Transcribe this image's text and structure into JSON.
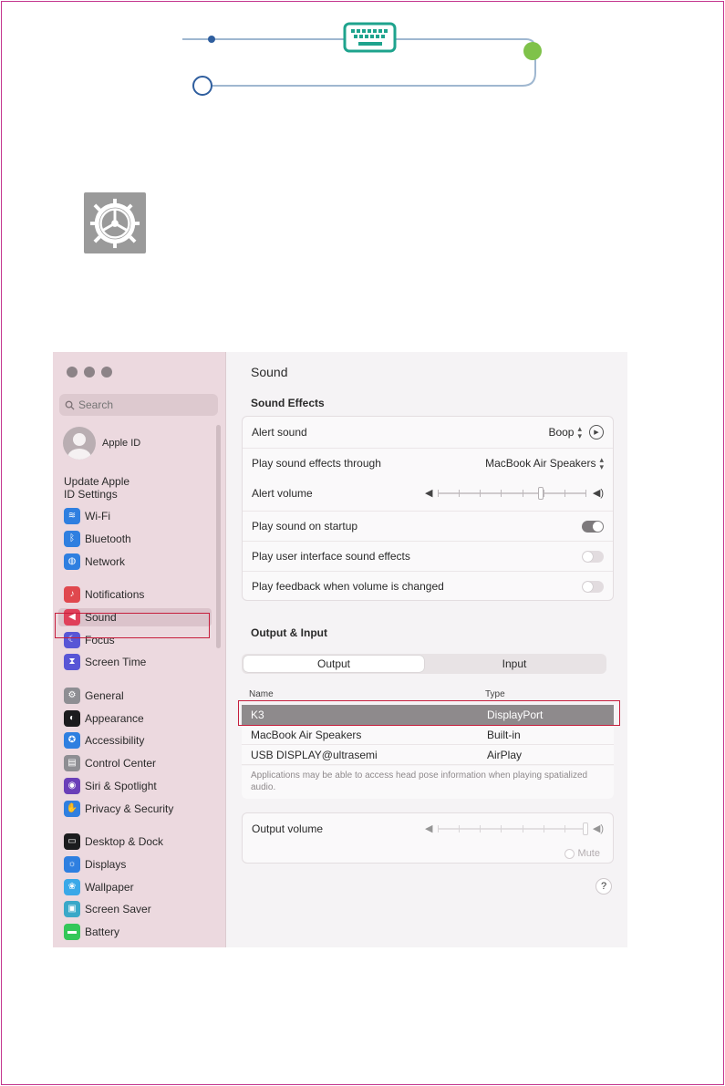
{
  "colors": {
    "page_border": "#c4368f",
    "highlight": "#c61e3c",
    "flow_line": "#9fb7d0",
    "flow_dot": "#2f5e9e",
    "flow_end": "#7fc24a",
    "keyboard": "#1ea38d"
  },
  "decor": {
    "keyboard_icon": "keyboard-icon",
    "settings_icon": "gear-icon"
  },
  "window": {
    "search": {
      "placeholder": "Search"
    },
    "sidebar": {
      "apple_id_label": "Apple ID",
      "update_line1": "Update Apple",
      "update_line2": "ID Settings",
      "items": [
        {
          "label": "Wi-Fi",
          "icon": "wifi-icon",
          "color": "#2f7fe0",
          "glyph": "≋"
        },
        {
          "label": "Bluetooth",
          "icon": "bluetooth-icon",
          "color": "#2f7fe0",
          "glyph": "ᛒ"
        },
        {
          "label": "Network",
          "icon": "network-icon",
          "color": "#2f7fe0",
          "glyph": "◍"
        },
        {
          "label": "Notifications",
          "icon": "notifications-icon",
          "color": "#e0484e",
          "glyph": "♪"
        },
        {
          "label": "Sound",
          "icon": "sound-icon",
          "color": "#e0405a",
          "glyph": "◀"
        },
        {
          "label": "Focus",
          "icon": "focus-icon",
          "color": "#5856d6",
          "glyph": "☾"
        },
        {
          "label": "Screen Time",
          "icon": "screen-time-icon",
          "color": "#5856d6",
          "glyph": "⧗"
        },
        {
          "label": "General",
          "icon": "general-icon",
          "color": "#8e8e93",
          "glyph": "⚙"
        },
        {
          "label": "Appearance",
          "icon": "appearance-icon",
          "color": "#1c1c1e",
          "glyph": "◐"
        },
        {
          "label": "Accessibility",
          "icon": "accessibility-icon",
          "color": "#2f7fe0",
          "glyph": "✪"
        },
        {
          "label": "Control Center",
          "icon": "control-center-icon",
          "color": "#8e8e93",
          "glyph": "▤"
        },
        {
          "label": "Siri & Spotlight",
          "icon": "siri-icon",
          "color": "#6a3fb8",
          "glyph": "◉"
        },
        {
          "label": "Privacy & Security",
          "icon": "privacy-icon",
          "color": "#2f7fe0",
          "glyph": "✋"
        },
        {
          "label": "Desktop & Dock",
          "icon": "desktop-dock-icon",
          "color": "#1c1c1e",
          "glyph": "▭"
        },
        {
          "label": "Displays",
          "icon": "displays-icon",
          "color": "#2f7fe0",
          "glyph": "☼"
        },
        {
          "label": "Wallpaper",
          "icon": "wallpaper-icon",
          "color": "#3aa8e8",
          "glyph": "❀"
        },
        {
          "label": "Screen Saver",
          "icon": "screen-saver-icon",
          "color": "#3aa8c8",
          "glyph": "▣"
        },
        {
          "label": "Battery",
          "icon": "battery-icon",
          "color": "#34c759",
          "glyph": "▬"
        }
      ]
    },
    "main": {
      "title": "Sound",
      "sound_effects": {
        "heading": "Sound Effects",
        "alert_sound_label": "Alert sound",
        "alert_sound_value": "Boop",
        "play_through_label": "Play sound effects through",
        "play_through_value": "MacBook Air Speakers",
        "alert_volume_label": "Alert volume",
        "alert_volume_level": 0.7,
        "startup_label": "Play sound on startup",
        "startup_on": true,
        "ui_sounds_label": "Play user interface sound effects",
        "ui_sounds_on": false,
        "feedback_label": "Play feedback when volume is changed",
        "feedback_on": false
      },
      "output_input": {
        "heading": "Output & Input",
        "tab_output": "Output",
        "tab_input": "Input",
        "col_name": "Name",
        "col_type": "Type",
        "devices": [
          {
            "name": "K3",
            "type": "DisplayPort",
            "selected": true
          },
          {
            "name": "MacBook Air Speakers",
            "type": "Built-in",
            "selected": false
          },
          {
            "name": "USB DISPLAY@ultrasemi",
            "type": "AirPlay",
            "selected": false
          }
        ],
        "note": "Applications may be able to access head pose information when playing spatialized audio.",
        "output_volume_label": "Output volume",
        "output_volume_level": 1.0,
        "mute_label": "Mute",
        "help_label": "?"
      }
    }
  }
}
